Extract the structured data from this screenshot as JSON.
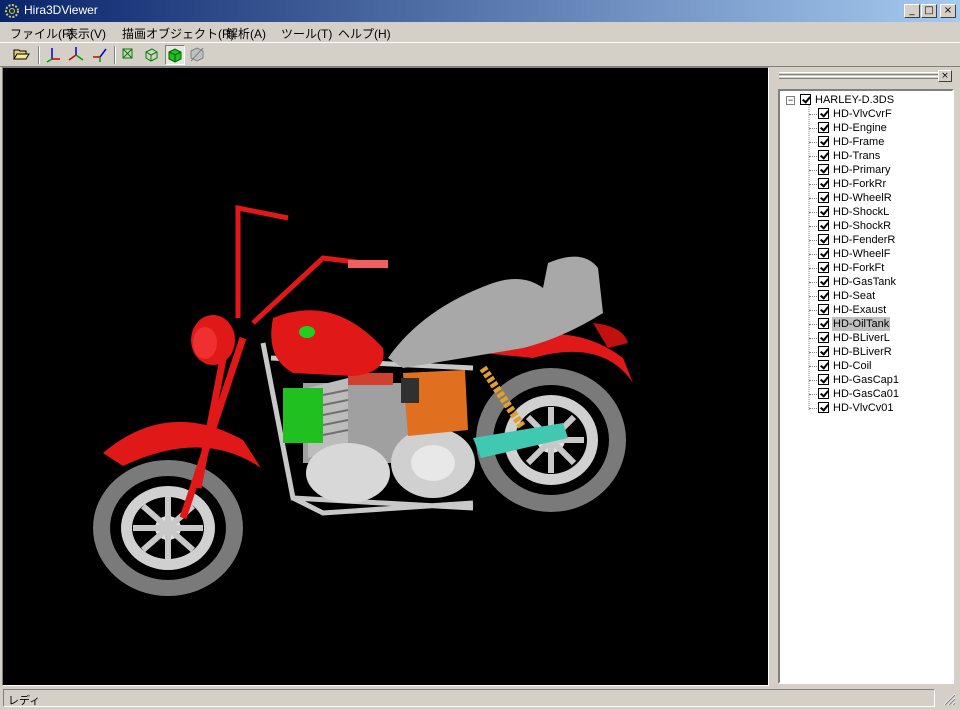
{
  "window": {
    "title": "Hira3DViewer",
    "app_icon": "gear-app-icon",
    "min": "_",
    "max": "□",
    "close": "×"
  },
  "menu": [
    "ファイル(F)",
    "表示(V)",
    "描画オブジェクト(R)",
    "解析(A)",
    "ツール(T)",
    "ヘルプ(H)"
  ],
  "toolbar": {
    "buttons": [
      {
        "icon": "open-folder-icon"
      },
      {
        "icon": "axis-xy-view-icon"
      },
      {
        "icon": "axis-yz-view-icon"
      },
      {
        "icon": "axis-zx-view-icon"
      },
      {
        "icon": "wireframe-icon"
      },
      {
        "icon": "hidden-line-icon"
      },
      {
        "icon": "solid-shading-icon",
        "pressed": true
      },
      {
        "icon": "disabled-render-icon"
      }
    ]
  },
  "panel": {
    "close": "×"
  },
  "tree": {
    "root": "HARLEY-D.3DS",
    "items": [
      "HD-VlvCvrF",
      "HD-Engine",
      "HD-Frame",
      "HD-Trans",
      "HD-Primary",
      "HD-ForkRr",
      "HD-WheelR",
      "HD-ShockL",
      "HD-ShockR",
      "HD-FenderR",
      "HD-WheelF",
      "HD-ForkFt",
      "HD-GasTank",
      "HD-Seat",
      "HD-Exaust",
      "HD-OilTank",
      "HD-BLiverL",
      "HD-BLiverR",
      "HD-Coil",
      "HD-GasCap1",
      "HD-GasCa01",
      "HD-VlvCv01"
    ],
    "selected": "HD-OilTank"
  },
  "status": {
    "text": "レディ"
  },
  "colors": {
    "titlebar_start": "#0a246a",
    "titlebar_end": "#a6caf0",
    "viewport_bg": "#000000",
    "frame_red": "#e01818",
    "tank_green": "#22cc22",
    "oiltank_orange": "#e07020",
    "swingarm_teal": "#40c8b0"
  }
}
